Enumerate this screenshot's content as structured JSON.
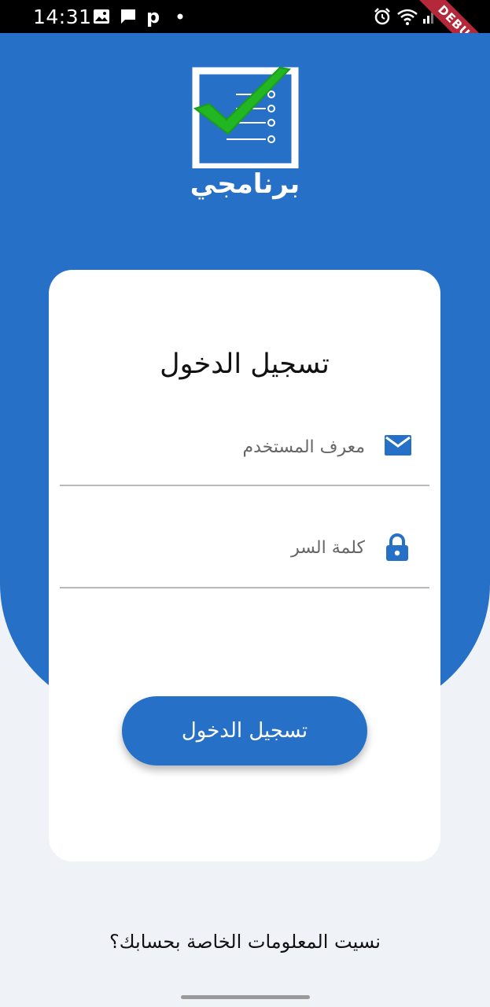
{
  "status_bar": {
    "time": "14:31",
    "debug_label": "DEBUG"
  },
  "app": {
    "logo_text": "برنامجي",
    "accent_color": "#2770c8",
    "check_color": "#22b623"
  },
  "login_card": {
    "title": "تسجيل الدخول",
    "username_placeholder": "معرف المستخدم",
    "username_value": "",
    "password_placeholder": "كلمة السر",
    "password_value": "",
    "submit_label": "تسجيل الدخول"
  },
  "footer": {
    "forgot_link": "نسيت المعلومات الخاصة بحسابك؟"
  }
}
